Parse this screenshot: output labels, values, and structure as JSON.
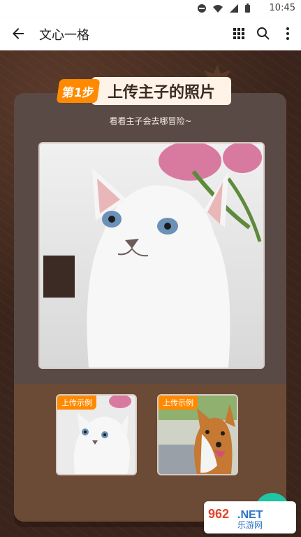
{
  "status_bar": {
    "time": "10:45",
    "icons": [
      "do-not-disturb-icon",
      "wifi-icon",
      "signal-icon",
      "battery-icon"
    ]
  },
  "app_bar": {
    "title": "文心一格",
    "back_icon": "back-arrow-icon",
    "grid_icon": "grid-icon",
    "search_icon": "search-icon",
    "more_icon": "more-vert-icon"
  },
  "step_badge": {
    "step": "第1步",
    "title": "上传主子的照片",
    "subtitle": "看看主子会去哪冒险~"
  },
  "examples": {
    "tag": "上传示例",
    "items": [
      {
        "label": "上传示例",
        "type": "cat"
      },
      {
        "label": "上传示例",
        "type": "dog"
      }
    ]
  },
  "colors": {
    "accent": "#ff8a00",
    "card": "#5a4a45",
    "bottom_panel": "#6b4b35",
    "bg": "#3a241b"
  },
  "watermark": {
    "text": "962.NET 乐游网"
  }
}
